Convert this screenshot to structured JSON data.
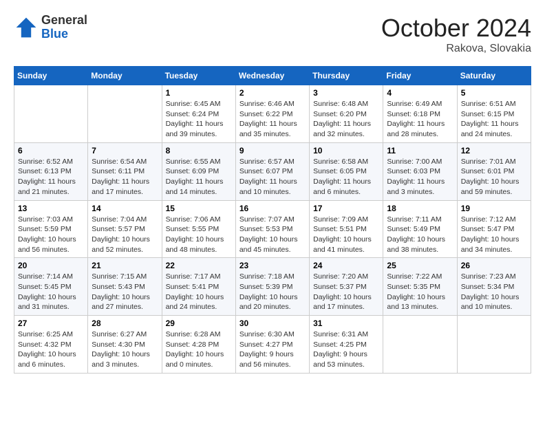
{
  "header": {
    "logo_general": "General",
    "logo_blue": "Blue",
    "month_title": "October 2024",
    "location": "Rakova, Slovakia"
  },
  "days_of_week": [
    "Sunday",
    "Monday",
    "Tuesday",
    "Wednesday",
    "Thursday",
    "Friday",
    "Saturday"
  ],
  "weeks": [
    [
      {
        "day": "",
        "info": ""
      },
      {
        "day": "",
        "info": ""
      },
      {
        "day": "1",
        "info": "Sunrise: 6:45 AM\nSunset: 6:24 PM\nDaylight: 11 hours and 39 minutes."
      },
      {
        "day": "2",
        "info": "Sunrise: 6:46 AM\nSunset: 6:22 PM\nDaylight: 11 hours and 35 minutes."
      },
      {
        "day": "3",
        "info": "Sunrise: 6:48 AM\nSunset: 6:20 PM\nDaylight: 11 hours and 32 minutes."
      },
      {
        "day": "4",
        "info": "Sunrise: 6:49 AM\nSunset: 6:18 PM\nDaylight: 11 hours and 28 minutes."
      },
      {
        "day": "5",
        "info": "Sunrise: 6:51 AM\nSunset: 6:15 PM\nDaylight: 11 hours and 24 minutes."
      }
    ],
    [
      {
        "day": "6",
        "info": "Sunrise: 6:52 AM\nSunset: 6:13 PM\nDaylight: 11 hours and 21 minutes."
      },
      {
        "day": "7",
        "info": "Sunrise: 6:54 AM\nSunset: 6:11 PM\nDaylight: 11 hours and 17 minutes."
      },
      {
        "day": "8",
        "info": "Sunrise: 6:55 AM\nSunset: 6:09 PM\nDaylight: 11 hours and 14 minutes."
      },
      {
        "day": "9",
        "info": "Sunrise: 6:57 AM\nSunset: 6:07 PM\nDaylight: 11 hours and 10 minutes."
      },
      {
        "day": "10",
        "info": "Sunrise: 6:58 AM\nSunset: 6:05 PM\nDaylight: 11 hours and 6 minutes."
      },
      {
        "day": "11",
        "info": "Sunrise: 7:00 AM\nSunset: 6:03 PM\nDaylight: 11 hours and 3 minutes."
      },
      {
        "day": "12",
        "info": "Sunrise: 7:01 AM\nSunset: 6:01 PM\nDaylight: 10 hours and 59 minutes."
      }
    ],
    [
      {
        "day": "13",
        "info": "Sunrise: 7:03 AM\nSunset: 5:59 PM\nDaylight: 10 hours and 56 minutes."
      },
      {
        "day": "14",
        "info": "Sunrise: 7:04 AM\nSunset: 5:57 PM\nDaylight: 10 hours and 52 minutes."
      },
      {
        "day": "15",
        "info": "Sunrise: 7:06 AM\nSunset: 5:55 PM\nDaylight: 10 hours and 48 minutes."
      },
      {
        "day": "16",
        "info": "Sunrise: 7:07 AM\nSunset: 5:53 PM\nDaylight: 10 hours and 45 minutes."
      },
      {
        "day": "17",
        "info": "Sunrise: 7:09 AM\nSunset: 5:51 PM\nDaylight: 10 hours and 41 minutes."
      },
      {
        "day": "18",
        "info": "Sunrise: 7:11 AM\nSunset: 5:49 PM\nDaylight: 10 hours and 38 minutes."
      },
      {
        "day": "19",
        "info": "Sunrise: 7:12 AM\nSunset: 5:47 PM\nDaylight: 10 hours and 34 minutes."
      }
    ],
    [
      {
        "day": "20",
        "info": "Sunrise: 7:14 AM\nSunset: 5:45 PM\nDaylight: 10 hours and 31 minutes."
      },
      {
        "day": "21",
        "info": "Sunrise: 7:15 AM\nSunset: 5:43 PM\nDaylight: 10 hours and 27 minutes."
      },
      {
        "day": "22",
        "info": "Sunrise: 7:17 AM\nSunset: 5:41 PM\nDaylight: 10 hours and 24 minutes."
      },
      {
        "day": "23",
        "info": "Sunrise: 7:18 AM\nSunset: 5:39 PM\nDaylight: 10 hours and 20 minutes."
      },
      {
        "day": "24",
        "info": "Sunrise: 7:20 AM\nSunset: 5:37 PM\nDaylight: 10 hours and 17 minutes."
      },
      {
        "day": "25",
        "info": "Sunrise: 7:22 AM\nSunset: 5:35 PM\nDaylight: 10 hours and 13 minutes."
      },
      {
        "day": "26",
        "info": "Sunrise: 7:23 AM\nSunset: 5:34 PM\nDaylight: 10 hours and 10 minutes."
      }
    ],
    [
      {
        "day": "27",
        "info": "Sunrise: 6:25 AM\nSunset: 4:32 PM\nDaylight: 10 hours and 6 minutes."
      },
      {
        "day": "28",
        "info": "Sunrise: 6:27 AM\nSunset: 4:30 PM\nDaylight: 10 hours and 3 minutes."
      },
      {
        "day": "29",
        "info": "Sunrise: 6:28 AM\nSunset: 4:28 PM\nDaylight: 10 hours and 0 minutes."
      },
      {
        "day": "30",
        "info": "Sunrise: 6:30 AM\nSunset: 4:27 PM\nDaylight: 9 hours and 56 minutes."
      },
      {
        "day": "31",
        "info": "Sunrise: 6:31 AM\nSunset: 4:25 PM\nDaylight: 9 hours and 53 minutes."
      },
      {
        "day": "",
        "info": ""
      },
      {
        "day": "",
        "info": ""
      }
    ]
  ]
}
